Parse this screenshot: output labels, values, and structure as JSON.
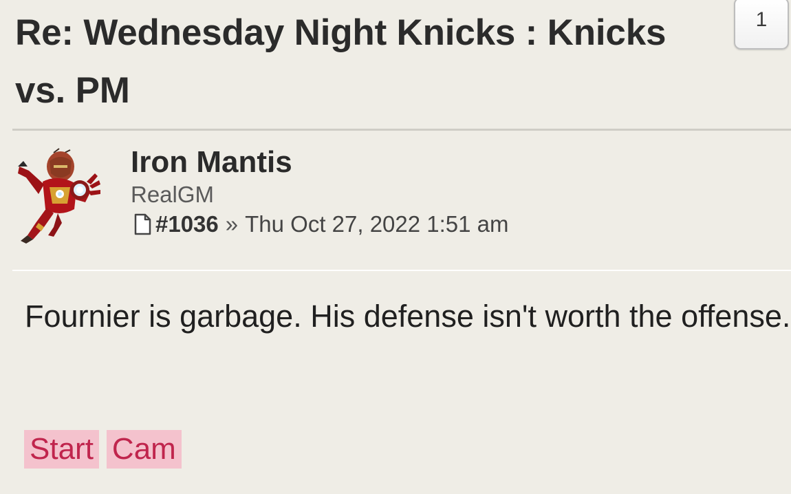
{
  "topic": {
    "title": "Re: Wednesday Night Knicks : Knicks vs. PM",
    "quote_count": "1"
  },
  "post": {
    "author": "Iron Mantis",
    "rank": "RealGM",
    "post_number": "#1036",
    "separator": "»",
    "date": "Thu Oct 27, 2022 1:51 am",
    "content": "Fournier is garbage. His defense isn't worth the offense.",
    "tags": [
      "Start",
      "Cam"
    ]
  },
  "icons": {
    "post_link": "file-icon",
    "avatar": "iron-man-avatar"
  },
  "colors": {
    "background": "#efede6",
    "tag_background": "#f4c2cd",
    "tag_text": "#c0254d"
  }
}
